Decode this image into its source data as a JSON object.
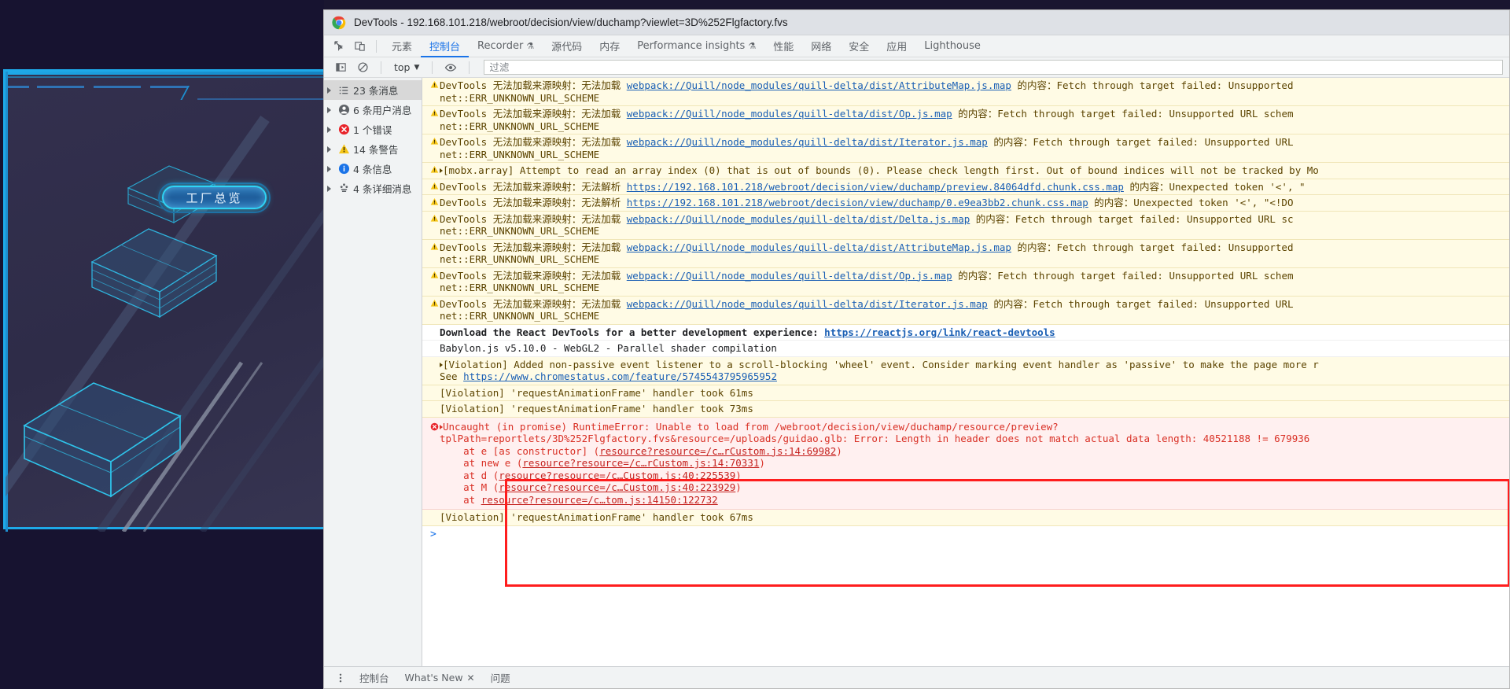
{
  "viewport": {
    "button_label": "工厂总览"
  },
  "window": {
    "title": "DevTools - 192.168.101.218/webroot/decision/view/duchamp?viewlet=3D%252Flgfactory.fvs",
    "logo_icon": "chrome-logo-icon"
  },
  "tabstrip": {
    "inspect_icon": "inspect-element-icon",
    "device_icon": "device-toolbar-icon",
    "tabs": [
      {
        "label": "元素",
        "active": false,
        "flask": false
      },
      {
        "label": "控制台",
        "active": true,
        "flask": false
      },
      {
        "label": "Recorder",
        "active": false,
        "flask": true
      },
      {
        "label": "源代码",
        "active": false,
        "flask": false
      },
      {
        "label": "内存",
        "active": false,
        "flask": false
      },
      {
        "label": "Performance insights",
        "active": false,
        "flask": true
      },
      {
        "label": "性能",
        "active": false,
        "flask": false
      },
      {
        "label": "网络",
        "active": false,
        "flask": false
      },
      {
        "label": "安全",
        "active": false,
        "flask": false
      },
      {
        "label": "应用",
        "active": false,
        "flask": false
      },
      {
        "label": "Lighthouse",
        "active": false,
        "flask": false
      }
    ]
  },
  "console_toolbar": {
    "sidebar_toggle_icon": "console-sidebar-icon",
    "clear_icon": "clear-console-icon",
    "context_value": "top",
    "chevron_icon": "chevron-down-icon",
    "eye_icon": "live-expression-eye-icon",
    "filter_placeholder": "过滤"
  },
  "sidebar": {
    "items": [
      {
        "label": "23 条消息",
        "icon": "list-icon",
        "selected": true
      },
      {
        "label": "6 条用户消息",
        "icon": "user-icon",
        "selected": false
      },
      {
        "label": "1 个错误",
        "icon": "error-icon",
        "selected": false
      },
      {
        "label": "14 条警告",
        "icon": "warning-icon",
        "selected": false
      },
      {
        "label": "4 条信息",
        "icon": "info-icon",
        "selected": false
      },
      {
        "label": "4 条详细消息",
        "icon": "verbose-icon",
        "selected": false
      }
    ]
  },
  "log": {
    "rows": [
      {
        "kind": "warn",
        "icon": "warning-icon",
        "pre": "DevTools 无法加载来源映射：无法加载 ",
        "link": "webpack://Quill/node_modules/quill-delta/dist/AttributeMap.js.map",
        "post": " 的内容：Fetch through target failed: Unsupported",
        "line2": "net::ERR_UNKNOWN_URL_SCHEME"
      },
      {
        "kind": "warn",
        "icon": "warning-icon",
        "pre": "DevTools 无法加载来源映射：无法加载 ",
        "link": "webpack://Quill/node_modules/quill-delta/dist/Op.js.map",
        "post": " 的内容：Fetch through target failed: Unsupported URL schem",
        "line2": "net::ERR_UNKNOWN_URL_SCHEME"
      },
      {
        "kind": "warn",
        "icon": "warning-icon",
        "pre": "DevTools 无法加载来源映射：无法加载 ",
        "link": "webpack://Quill/node_modules/quill-delta/dist/Iterator.js.map",
        "post": " 的内容：Fetch through target failed: Unsupported URL",
        "line2": "net::ERR_UNKNOWN_URL_SCHEME"
      },
      {
        "kind": "warn",
        "icon": "warning-icon",
        "expand": true,
        "pre": "[mobx.array] Attempt to read an array index (0) that is out of bounds (0). Please check length first. Out of bound indices will not be tracked by Mo",
        "link": "",
        "post": "",
        "line2": ""
      },
      {
        "kind": "warn",
        "icon": "warning-icon",
        "pre": "DevTools 无法加载来源映射：无法解析 ",
        "link": "https://192.168.101.218/webroot/decision/view/duchamp/preview.84064dfd.chunk.css.map",
        "post": " 的内容：Unexpected token '<', \"",
        "line2": ""
      },
      {
        "kind": "warn",
        "icon": "warning-icon",
        "pre": "DevTools 无法加载来源映射：无法解析 ",
        "link": "https://192.168.101.218/webroot/decision/view/duchamp/0.e9ea3bb2.chunk.css.map",
        "post": " 的内容：Unexpected token '<', \"<!DO",
        "line2": ""
      },
      {
        "kind": "warn",
        "icon": "warning-icon",
        "pre": "DevTools 无法加载来源映射：无法加载 ",
        "link": "webpack://Quill/node_modules/quill-delta/dist/Delta.js.map",
        "post": " 的内容：Fetch through target failed: Unsupported URL sc",
        "line2": "net::ERR_UNKNOWN_URL_SCHEME"
      },
      {
        "kind": "warn",
        "icon": "warning-icon",
        "pre": "DevTools 无法加载来源映射：无法加载 ",
        "link": "webpack://Quill/node_modules/quill-delta/dist/AttributeMap.js.map",
        "post": " 的内容：Fetch through target failed: Unsupported",
        "line2": "net::ERR_UNKNOWN_URL_SCHEME"
      },
      {
        "kind": "warn",
        "icon": "warning-icon",
        "pre": "DevTools 无法加载来源映射：无法加载 ",
        "link": "webpack://Quill/node_modules/quill-delta/dist/Op.js.map",
        "post": " 的内容：Fetch through target failed: Unsupported URL schem",
        "line2": "net::ERR_UNKNOWN_URL_SCHEME"
      },
      {
        "kind": "warn",
        "icon": "warning-icon",
        "pre": "DevTools 无法加载来源映射：无法加载 ",
        "link": "webpack://Quill/node_modules/quill-delta/dist/Iterator.js.map",
        "post": " 的内容：Fetch through target failed: Unsupported URL",
        "line2": "net::ERR_UNKNOWN_URL_SCHEME"
      }
    ],
    "react_notice": {
      "pre": "Download the React DevTools for a better development experience: ",
      "link": "https://reactjs.org/link/react-devtools"
    },
    "babylon_notice": "Babylon.js v5.10.0 - WebGL2 - Parallel shader compilation",
    "violation_wheel": {
      "line1": "[Violation] Added non-passive event listener to a scroll-blocking 'wheel' event. Consider marking event handler as 'passive' to make the page more r",
      "line2_pre": "See ",
      "line2_link": "https://www.chromestatus.com/feature/5745543795965952"
    },
    "violation_raf_1": "[Violation] 'requestAnimationFrame' handler took 61ms",
    "violation_raf_2": "[Violation] 'requestAnimationFrame' handler took 73ms",
    "violation_raf_3": "[Violation] 'requestAnimationFrame' handler took 67ms",
    "error": {
      "line1": "Uncaught (in promise) RuntimeError: Unable to load from /webroot/decision/view/duchamp/resource/preview?",
      "line2": "tplPath=reportlets/3D%252Flgfactory.fvs&resource=/uploads/guidao.glb: Error: Length in header does not match actual data length: 40521188 != 679936",
      "stack": [
        {
          "pre": "    at e [as constructor] (",
          "link": "resource?resource=/c…rCustom.js:14:69982",
          "post": ")"
        },
        {
          "pre": "    at new e (",
          "link": "resource?resource=/c…rCustom.js:14:70331",
          "post": ")"
        },
        {
          "pre": "    at d (",
          "link": "resource?resource=/c…Custom.js:40:225539",
          "post": ")"
        },
        {
          "pre": "    at M (",
          "link": "resource?resource=/c…Custom.js:40:223929",
          "post": ")"
        },
        {
          "pre": "    at ",
          "link": "resource?resource=/c…tom.js:14150:122732",
          "post": ""
        }
      ]
    },
    "prompt_symbol": ">"
  },
  "drawer": {
    "menu_icon": "more-options-icon",
    "tabs": [
      {
        "label": "控制台",
        "active": false,
        "close": false
      },
      {
        "label": "What's New",
        "active": false,
        "close": true
      },
      {
        "label": "问题",
        "active": false,
        "close": false
      }
    ],
    "close_icon": "close-icon"
  },
  "colors": {
    "accent": "#1a73e8",
    "error": "#d93025",
    "error_outline": "#ff1d1d",
    "warn_bg": "#fffbe5",
    "err_bg": "#fff0f0",
    "hud_cyan": "#1ea9e8"
  }
}
